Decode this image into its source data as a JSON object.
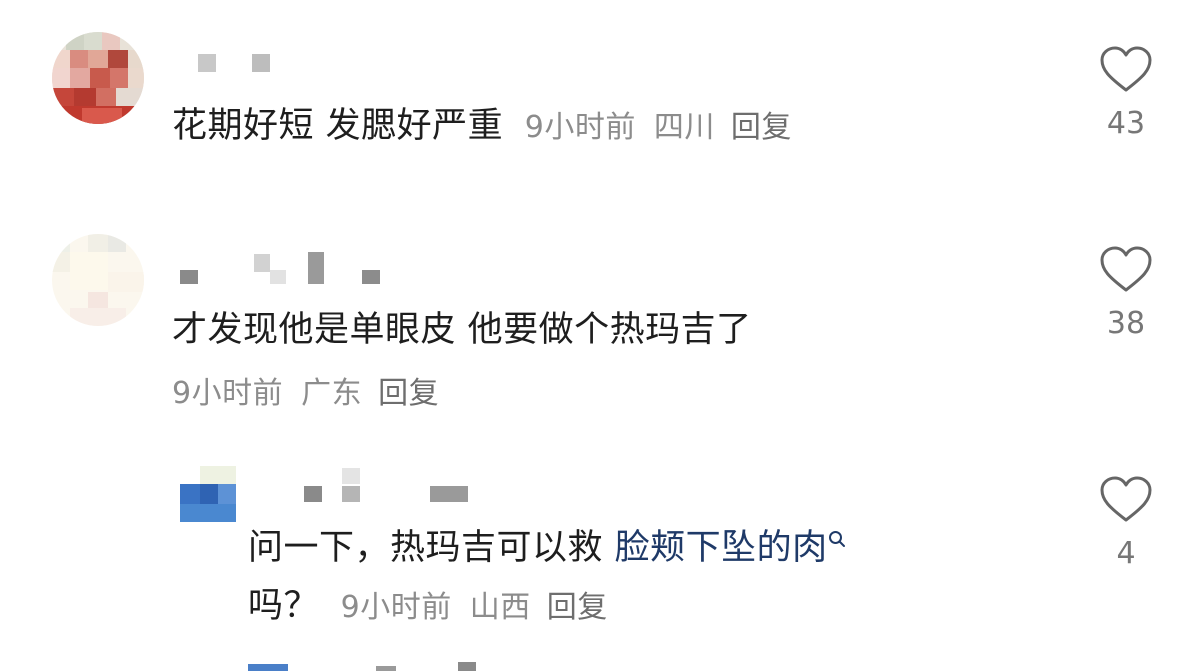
{
  "comments": [
    {
      "text": "花期好短 发腮好严重",
      "time": "9小时前",
      "location": "四川",
      "reply_label": "回复",
      "likes": "43"
    },
    {
      "text": "才发现他是单眼皮 他要做个热玛吉了",
      "time": "9小时前",
      "location": "广东",
      "reply_label": "回复",
      "likes": "38"
    },
    {
      "text_before_link": "问一下，热玛吉可以救 ",
      "link_text": "脸颊下坠的肉",
      "text_after_link": "吗？",
      "time": "9小时前",
      "location": "山西",
      "reply_label": "回复",
      "likes": "4"
    }
  ],
  "colors": {
    "text": "#1e1e1e",
    "meta": "#8c8c8c",
    "link": "#1f3a68",
    "icon": "#666666"
  },
  "icons": {
    "like": "heart-outline-icon",
    "search": "search-icon"
  }
}
